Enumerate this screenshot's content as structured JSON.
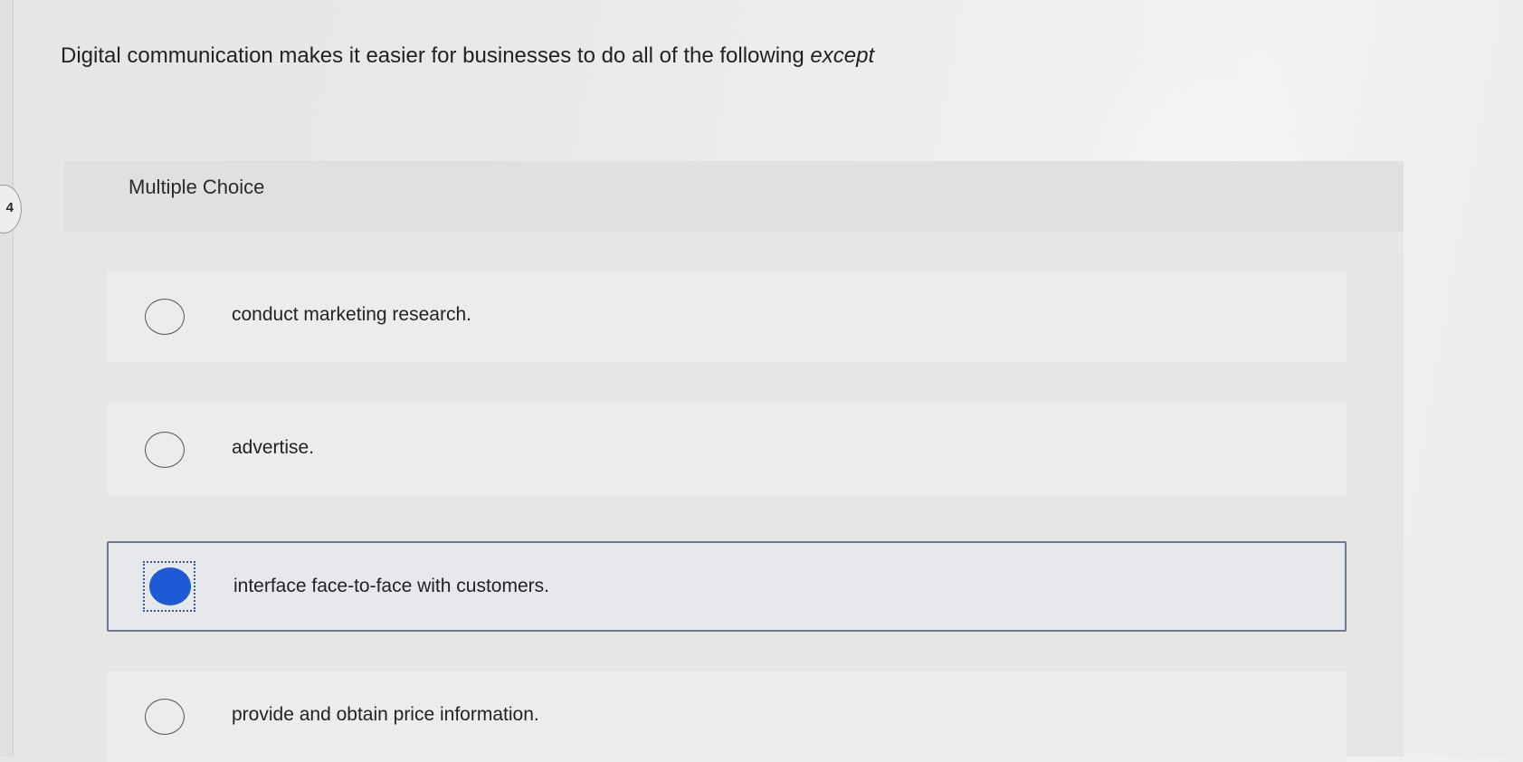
{
  "question": {
    "number": "4",
    "text_main": "Digital communication makes it easier for businesses to do all of the following ",
    "text_emphasis": "except"
  },
  "question_type": "Multiple Choice",
  "options": [
    {
      "label": "conduct marketing research.",
      "selected": false
    },
    {
      "label": "advertise.",
      "selected": false
    },
    {
      "label": "interface face-to-face with customers.",
      "selected": true
    },
    {
      "label": "provide and obtain price information.",
      "selected": false
    }
  ],
  "colors": {
    "selected_radio": "#1d5bd6",
    "selected_border": "#6a7a96"
  }
}
